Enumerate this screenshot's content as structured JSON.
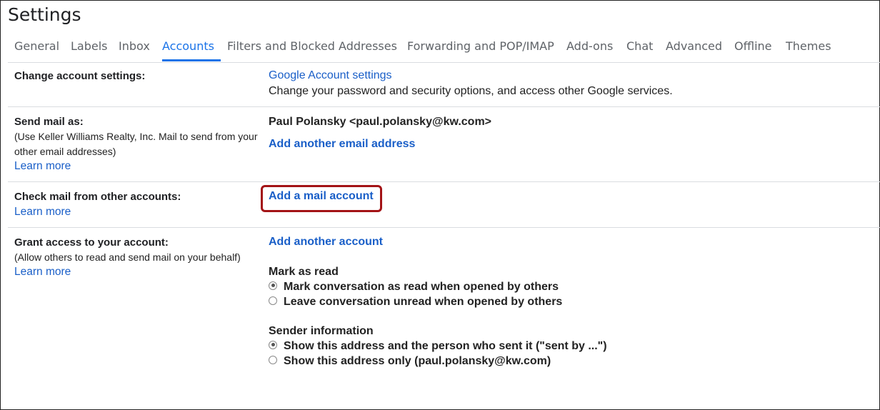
{
  "title": "Settings",
  "tabs": [
    {
      "label": "General"
    },
    {
      "label": "Labels"
    },
    {
      "label": "Inbox"
    },
    {
      "label": "Accounts",
      "active": true
    },
    {
      "label": "Filters and Blocked Addresses"
    },
    {
      "label": "Forwarding and POP/IMAP"
    },
    {
      "label": "Add-ons"
    },
    {
      "label": "Chat"
    },
    {
      "label": "Advanced"
    },
    {
      "label": "Offline"
    },
    {
      "label": "Themes"
    }
  ],
  "change_account": {
    "label": "Change account settings:",
    "link": "Google Account settings",
    "description": "Change your password and security options, and access other Google services."
  },
  "send_mail": {
    "label": "Send mail as:",
    "sub1": "(Use Keller Williams Realty, Inc. Mail to send from your",
    "sub2": "other email addresses)",
    "learn_more": "Learn more",
    "identity": "Paul Polansky <paul.polansky@kw.com>",
    "add_link": "Add another email address"
  },
  "check_mail": {
    "label": "Check mail from other accounts:",
    "learn_more": "Learn more",
    "add_link": "Add a mail account"
  },
  "grant_access": {
    "label": "Grant access to your account:",
    "sub": "(Allow others to read and send mail on your behalf)",
    "learn_more": "Learn more",
    "add_link": "Add another account",
    "mark_as_read": {
      "heading": "Mark as read",
      "option1": "Mark conversation as read when opened by others",
      "option2": "Leave conversation unread when opened by others",
      "selected": 1
    },
    "sender_info": {
      "heading": "Sender information",
      "option1": "Show this address and the person who sent it (\"sent by ...\")",
      "option2": "Show this address only (paul.polansky@kw.com)",
      "selected": 1
    }
  },
  "colors": {
    "accent": "#1a73e8",
    "link": "#1a5fc8",
    "highlight": "#a31316"
  }
}
